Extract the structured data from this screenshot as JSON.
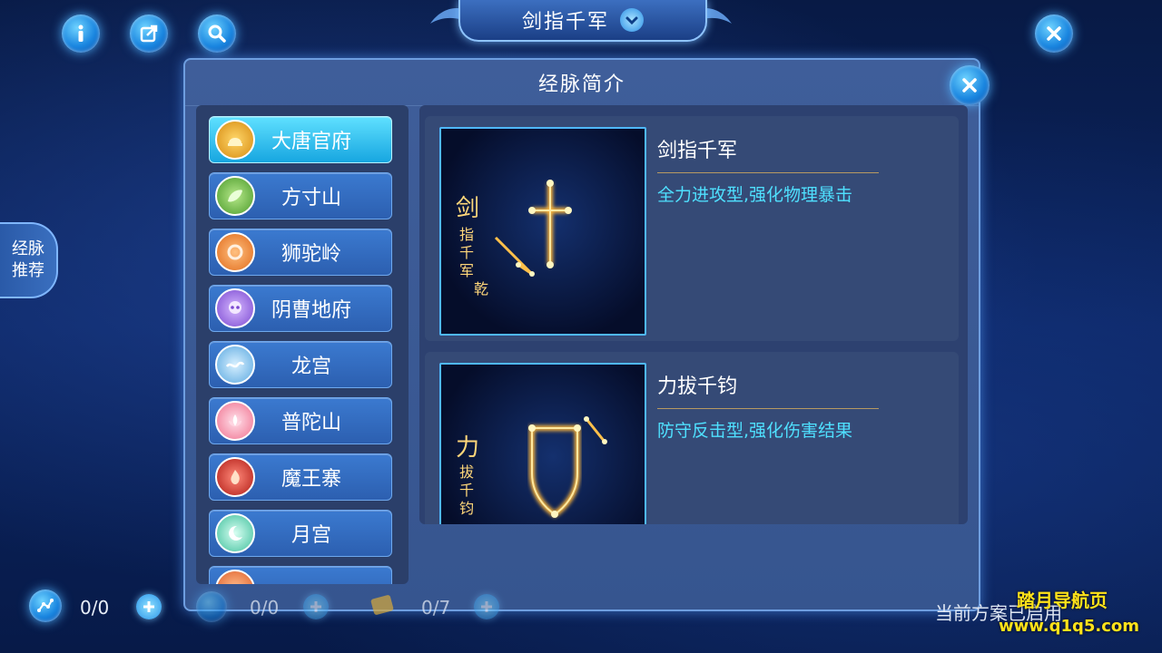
{
  "header": {
    "scheme_title": "剑指千军",
    "icons": [
      "info-icon",
      "share-icon",
      "search-icon",
      "close-icon"
    ]
  },
  "side_tab": {
    "line1": "经脉",
    "line2": "推荐"
  },
  "panel": {
    "title": "经脉简介",
    "sects": [
      {
        "label": "大唐官府",
        "icon": "helmet-icon",
        "color": "#f2b320",
        "active": true
      },
      {
        "label": "方寸山",
        "icon": "leaf-icon",
        "color": "#6fbf3a"
      },
      {
        "label": "狮驼岭",
        "icon": "lion-icon",
        "color": "#f08a2a"
      },
      {
        "label": "阴曹地府",
        "icon": "skull-icon",
        "color": "#9a6ee8"
      },
      {
        "label": "龙宫",
        "icon": "wave-icon",
        "color": "#5ab0e8"
      },
      {
        "label": "普陀山",
        "icon": "lotus-icon",
        "color": "#f26a8c"
      },
      {
        "label": "魔王寨",
        "icon": "flame-icon",
        "color": "#d0302a"
      },
      {
        "label": "月宫",
        "icon": "moon-icon",
        "color": "#4fd0b0"
      },
      {
        "label": "",
        "icon": "partial-icon",
        "color": "#f07a3a"
      }
    ],
    "paths": [
      {
        "name": "剑指千军",
        "desc": "全力进攻型,强化物理暴击",
        "art_text": [
          "剑",
          "指",
          "千",
          "军",
          "乾"
        ]
      },
      {
        "name": "力拔千钧",
        "desc": "防守反击型,强化伤害结果",
        "art_text": [
          "力",
          "拔",
          "千",
          "钧"
        ]
      }
    ]
  },
  "bottom": {
    "stat1": "0/0",
    "stat2": "0/0",
    "stat3": "0/7",
    "status": "当前方案已启用"
  },
  "watermark": {
    "line1": "踏月导航页",
    "line2": "www.q1q5.com"
  }
}
